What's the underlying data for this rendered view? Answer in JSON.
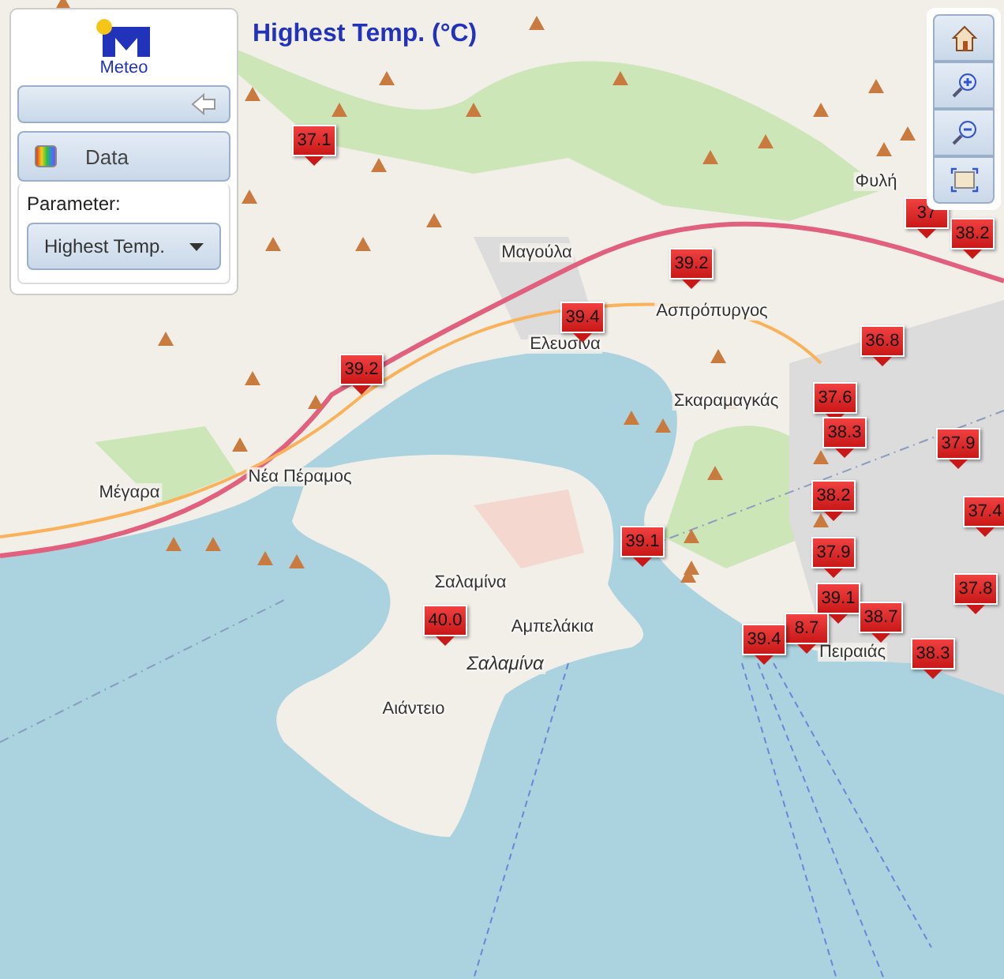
{
  "title": "Highest Temp. (°C)",
  "logo": {
    "text": "Meteo"
  },
  "panel": {
    "data_button": "Data",
    "parameter_label": "Parameter:",
    "parameter_select": "Highest Temp."
  },
  "places": [
    {
      "name": "Μαγούλα",
      "kind": "town"
    },
    {
      "name": "Ασπρόπυργος",
      "kind": "town"
    },
    {
      "name": "Ελευσίνα",
      "kind": "town"
    },
    {
      "name": "Φυλή",
      "kind": "town"
    },
    {
      "name": "Σκαραμαγκάς",
      "kind": "town"
    },
    {
      "name": "Νέα Πέραμος",
      "kind": "town"
    },
    {
      "name": "Μέγαρα",
      "kind": "town"
    },
    {
      "name": "Σαλαμίνα",
      "kind": "town"
    },
    {
      "name": "Αμπελάκια",
      "kind": "town"
    },
    {
      "name": "Σαλαμίνα",
      "kind": "island"
    },
    {
      "name": "Αιάντειο",
      "kind": "town"
    },
    {
      "name": "Πειραιάς",
      "kind": "town"
    }
  ],
  "markers": [
    {
      "value": "37.1"
    },
    {
      "value": "39.2"
    },
    {
      "value": "39.4"
    },
    {
      "value": "39.2"
    },
    {
      "value": "36.8"
    },
    {
      "value": "37.6"
    },
    {
      "value": "38.3"
    },
    {
      "value": "37.9"
    },
    {
      "value": "38.2"
    },
    {
      "value": "37.4"
    },
    {
      "value": "39.1"
    },
    {
      "value": "37.9"
    },
    {
      "value": "39.1"
    },
    {
      "value": "8.7"
    },
    {
      "value": "38.7"
    },
    {
      "value": "39.4"
    },
    {
      "value": "38.3"
    },
    {
      "value": "37.8"
    },
    {
      "value": "40.0"
    },
    {
      "value": "38.2"
    },
    {
      "value": "37"
    }
  ]
}
